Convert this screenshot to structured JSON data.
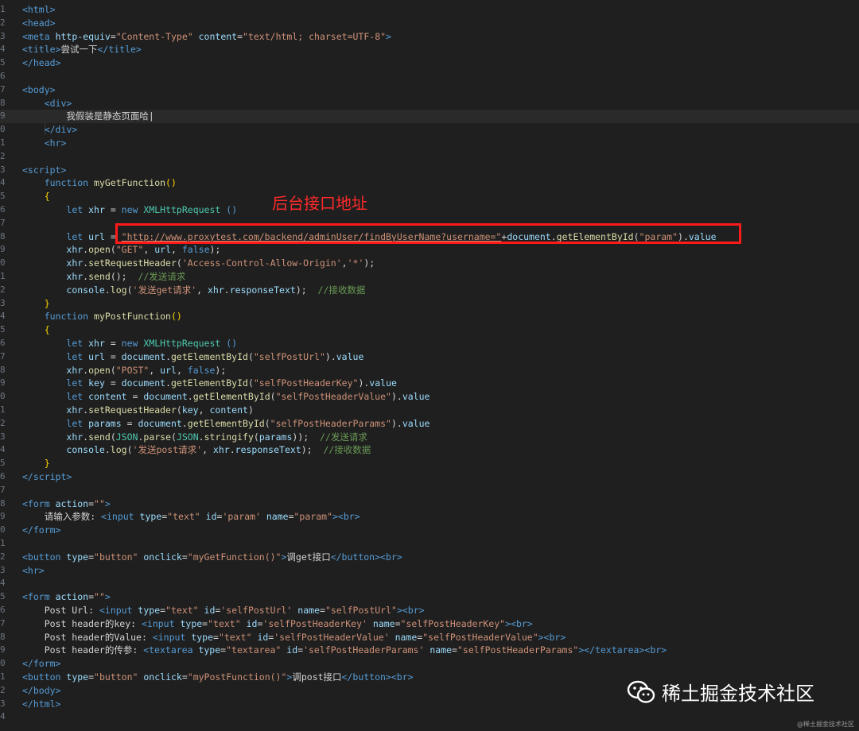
{
  "top_fragment": "                  ",
  "annotation": "后台接口地址",
  "watermark": {
    "brand": "稀土掘金技术社区",
    "small": "@稀土掘金技术社区",
    "icon": "wechat-icon"
  },
  "code": {
    "lines": [
      {
        "n": "1",
        "html": "<span class='t'>&lt;html&gt;</span>"
      },
      {
        "n": "2",
        "html": "<span class='t'>&lt;head&gt;</span>"
      },
      {
        "n": "3",
        "html": "<span class='t'>&lt;meta</span> <span class='a'>http-equiv</span>=<span class='s'>\"Content-Type\"</span> <span class='a'>content</span>=<span class='s'>\"text/html; charset=UTF-8\"</span><span class='t'>&gt;</span>"
      },
      {
        "n": "4",
        "html": "<span class='t'>&lt;title&gt;</span>尝试一下<span class='t'>&lt;/title&gt;</span>"
      },
      {
        "n": "5",
        "html": "<span class='t'>&lt;/head&gt;</span>"
      },
      {
        "n": "6",
        "html": ""
      },
      {
        "n": "7",
        "html": "<span class='t'>&lt;body&gt;</span>"
      },
      {
        "n": "8",
        "html": "    <span class='t'>&lt;div&gt;</span>"
      },
      {
        "n": "9",
        "html": "        我假装是静态页面哈|"
      },
      {
        "n": "0",
        "html": "    <span class='t'>&lt;/div&gt;</span>"
      },
      {
        "n": "1",
        "html": "    <span class='t'>&lt;hr&gt;</span>"
      },
      {
        "n": "2",
        "html": ""
      },
      {
        "n": "3",
        "html": "<span class='t'>&lt;script&gt;</span>"
      },
      {
        "n": "4",
        "html": "    <span class='k'>function</span> <span class='f'>myGetFunction</span><span class='y'>()</span>"
      },
      {
        "n": "5",
        "html": "    <span class='y'>{</span>"
      },
      {
        "n": "6",
        "html": "        <span class='k'>let</span> <span class='a'>xhr</span> = <span class='k'>new</span> <span class='cl'>XMLHttpRequest</span> <span class='t'>()</span>"
      },
      {
        "n": "7",
        "html": ""
      },
      {
        "n": "8",
        "html": "        <span class='k'>let</span> <span class='a'>url</span> = <span class='s u'>\"http://www.proxytest.com/backend/adminUser/findByUserName?username=\"</span>+<span class='a'>document</span>.<span class='f'>getElementById</span>(<span class='s'>\"param\"</span>).<span class='a'>value</span>"
      },
      {
        "n": "9",
        "html": "        <span class='a'>xhr</span>.<span class='f'>open</span>(<span class='s'>\"GET\"</span>, <span class='a'>url</span>, <span class='k'>false</span>);"
      },
      {
        "n": "0",
        "html": "        <span class='a'>xhr</span>.<span class='f'>setRequestHeader</span>(<span class='s'>'Access-Control-Allow-Origin'</span>,<span class='s'>'*'</span>);"
      },
      {
        "n": "1",
        "html": "        <span class='a'>xhr</span>.<span class='f'>send</span>();  <span class='c'>//发送请求</span>"
      },
      {
        "n": "2",
        "html": "        <span class='a'>console</span>.<span class='f'>log</span>(<span class='s'>'发送get请求'</span>, <span class='a'>xhr</span>.<span class='a'>responseText</span>);  <span class='c'>//接收数据</span>"
      },
      {
        "n": "3",
        "html": "    <span class='y'>}</span>"
      },
      {
        "n": "4",
        "html": "    <span class='k'>function</span> <span class='f'>myPostFunction</span><span class='y'>()</span>"
      },
      {
        "n": "5",
        "html": "    <span class='y'>{</span>"
      },
      {
        "n": "6",
        "html": "        <span class='k'>let</span> <span class='a'>xhr</span> = <span class='k'>new</span> <span class='cl'>XMLHttpRequest</span> <span class='t'>()</span>"
      },
      {
        "n": "7",
        "html": "        <span class='k'>let</span> <span class='a'>url</span> = <span class='a'>document</span>.<span class='f'>getElementById</span>(<span class='s'>\"selfPostUrl\"</span>).<span class='a'>value</span>"
      },
      {
        "n": "8",
        "html": "        <span class='a'>xhr</span>.<span class='f'>open</span>(<span class='s'>\"POST\"</span>, <span class='a'>url</span>, <span class='k'>false</span>);"
      },
      {
        "n": "9",
        "html": "        <span class='k'>let</span> <span class='a'>key</span> = <span class='a'>document</span>.<span class='f'>getElementById</span>(<span class='s'>\"selfPostHeaderKey\"</span>).<span class='a'>value</span>"
      },
      {
        "n": "0",
        "html": "        <span class='k'>let</span> <span class='a'>content</span> = <span class='a'>document</span>.<span class='f'>getElementById</span>(<span class='s'>\"selfPostHeaderValue\"</span>).<span class='a'>value</span>"
      },
      {
        "n": "1",
        "html": "        <span class='a'>xhr</span>.<span class='f'>setRequestHeader</span>(<span class='a'>key</span>, <span class='a'>content</span>)"
      },
      {
        "n": "2",
        "html": "        <span class='k'>let</span> <span class='a'>params</span> = <span class='a'>document</span>.<span class='f'>getElementById</span>(<span class='s'>\"selfPostHeaderParams\"</span>).<span class='a'>value</span>"
      },
      {
        "n": "3",
        "html": "        <span class='a'>xhr</span>.<span class='f'>send</span>(<span class='cl'>JSON</span>.<span class='f'>parse</span>(<span class='cl'>JSON</span>.<span class='f'>stringify</span>(<span class='a'>params</span>));  <span class='c'>//发送请求</span>"
      },
      {
        "n": "4",
        "html": "        <span class='a'>console</span>.<span class='f'>log</span>(<span class='s'>'发送post请求'</span>, <span class='a'>xhr</span>.<span class='a'>responseText</span>);  <span class='c'>//接收数据</span>"
      },
      {
        "n": "5",
        "html": "    <span class='y'>}</span>"
      },
      {
        "n": "6",
        "html": "<span class='t'>&lt;/script&gt;</span>"
      },
      {
        "n": "7",
        "html": ""
      },
      {
        "n": "8",
        "html": "<span class='t'>&lt;form</span> <span class='a'>action</span>=<span class='s'>\"\"</span><span class='t'>&gt;</span>"
      },
      {
        "n": "9",
        "html": "    请输入参数: <span class='t'>&lt;input</span> <span class='a'>type</span>=<span class='s'>\"text\"</span> <span class='a'>id</span>=<span class='s'>'param'</span> <span class='a'>name</span>=<span class='s'>\"param\"</span><span class='t'>&gt;&lt;br&gt;</span>"
      },
      {
        "n": "0",
        "html": "<span class='t'>&lt;/form&gt;</span>"
      },
      {
        "n": "1",
        "html": ""
      },
      {
        "n": "2",
        "html": "<span class='t'>&lt;button</span> <span class='a'>type</span>=<span class='s'>\"button\"</span> <span class='a'>onclick</span>=<span class='s'>\"myGetFunction()\"</span><span class='t'>&gt;</span>调get接口<span class='t'>&lt;/button&gt;&lt;br&gt;</span>"
      },
      {
        "n": "3",
        "html": "<span class='t'>&lt;hr&gt;</span>"
      },
      {
        "n": "4",
        "html": ""
      },
      {
        "n": "5",
        "html": "<span class='t'>&lt;form</span> <span class='a'>action</span>=<span class='s'>\"\"</span><span class='t'>&gt;</span>"
      },
      {
        "n": "6",
        "html": "    Post Url: <span class='t'>&lt;input</span> <span class='a'>type</span>=<span class='s'>\"text\"</span> <span class='a'>id</span>=<span class='s'>'selfPostUrl'</span> <span class='a'>name</span>=<span class='s'>\"selfPostUrl\"</span><span class='t'>&gt;&lt;br&gt;</span>"
      },
      {
        "n": "7",
        "html": "    Post header的key: <span class='t'>&lt;input</span> <span class='a'>type</span>=<span class='s'>\"text\"</span> <span class='a'>id</span>=<span class='s'>'selfPostHeaderKey'</span> <span class='a'>name</span>=<span class='s'>\"selfPostHeaderKey\"</span><span class='t'>&gt;&lt;br&gt;</span>"
      },
      {
        "n": "8",
        "html": "    Post header的Value: <span class='t'>&lt;input</span> <span class='a'>type</span>=<span class='s'>\"text\"</span> <span class='a'>id</span>=<span class='s'>'selfPostHeaderValue'</span> <span class='a'>name</span>=<span class='s'>\"selfPostHeaderValue\"</span><span class='t'>&gt;&lt;br&gt;</span>"
      },
      {
        "n": "9",
        "html": "    Post header的传参: <span class='t'>&lt;textarea</span> <span class='a'>type</span>=<span class='s'>\"textarea\"</span> <span class='a'>id</span>=<span class='s'>'selfPostHeaderParams'</span> <span class='a'>name</span>=<span class='s'>\"selfPostHeaderParams\"</span><span class='t'>&gt;&lt;/textarea&gt;&lt;br&gt;</span>"
      },
      {
        "n": "0",
        "html": "<span class='t'>&lt;/form&gt;</span>"
      },
      {
        "n": "1",
        "html": "<span class='t'>&lt;button</span> <span class='a'>type</span>=<span class='s'>\"button\"</span> <span class='a'>onclick</span>=<span class='s'>\"myPostFunction()\"</span><span class='t'>&gt;</span>调post接口<span class='t'>&lt;/button&gt;&lt;br&gt;</span>"
      },
      {
        "n": "2",
        "html": "<span class='t'>&lt;/body&gt;</span>"
      },
      {
        "n": "3",
        "html": "<span class='t'>&lt;/html&gt;</span>"
      },
      {
        "n": "4",
        "html": ""
      }
    ]
  }
}
